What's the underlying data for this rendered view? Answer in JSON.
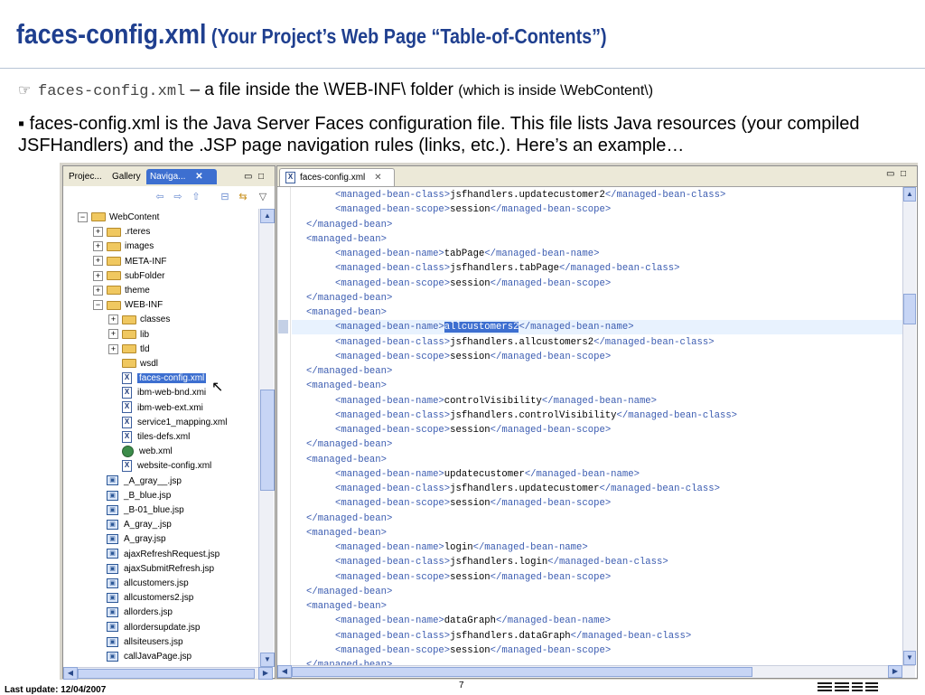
{
  "slide": {
    "title_main": "faces-config.xml",
    "title_sub": " (Your Project’s Web Page “Table-of-Contents”)",
    "bullet1_glyph": "☞",
    "bullet1_mono": "faces-config.xml",
    "bullet1_text": " – a file inside the \\WEB-INF\\ folder ",
    "bullet1_small": "(which is inside \\WebContent\\)",
    "bullet2_glyph": "▪",
    "bullet2_text": " faces-config.xml is the Java Server Faces configuration file. This file lists Java resources (your compiled JSFHandlers) and the .JSP page navigation rules (links, etc.).   Here’s an example…",
    "footer_update": "Last update: 12/04/2007",
    "page_number": "7"
  },
  "navigator": {
    "tabs": [
      "Projec...",
      "Gallery",
      "Naviga..."
    ],
    "close_glyph": "✕",
    "min_glyph": "▭",
    "max_glyph": "□",
    "tool_icons": [
      "⇦",
      "⇨",
      "⇧",
      "⊟",
      "⇆",
      "▽"
    ],
    "tree": [
      {
        "label": "WebContent",
        "icon": "folder",
        "indent": 0,
        "exp": "−"
      },
      {
        "label": ".rteres",
        "icon": "folder",
        "indent": 1,
        "exp": "+"
      },
      {
        "label": "images",
        "icon": "folder",
        "indent": 1,
        "exp": "+"
      },
      {
        "label": "META-INF",
        "icon": "folder",
        "indent": 1,
        "exp": "+"
      },
      {
        "label": "subFolder",
        "icon": "folder",
        "indent": 1,
        "exp": "+"
      },
      {
        "label": "theme",
        "icon": "folder",
        "indent": 1,
        "exp": "+"
      },
      {
        "label": "WEB-INF",
        "icon": "folder",
        "indent": 1,
        "exp": "−"
      },
      {
        "label": "classes",
        "icon": "folder",
        "indent": 2,
        "exp": "+"
      },
      {
        "label": "lib",
        "icon": "folder",
        "indent": 2,
        "exp": "+"
      },
      {
        "label": "tld",
        "icon": "folder",
        "indent": 2,
        "exp": "+"
      },
      {
        "label": "wsdl",
        "icon": "folder",
        "indent": 2,
        "exp": ""
      },
      {
        "label": "faces-config.xml",
        "icon": "xml",
        "indent": 2,
        "exp": "",
        "selected": true
      },
      {
        "label": "ibm-web-bnd.xmi",
        "icon": "xml",
        "indent": 2,
        "exp": ""
      },
      {
        "label": "ibm-web-ext.xmi",
        "icon": "xml",
        "indent": 2,
        "exp": ""
      },
      {
        "label": "service1_mapping.xml",
        "icon": "xml",
        "indent": 2,
        "exp": ""
      },
      {
        "label": "tiles-defs.xml",
        "icon": "xml",
        "indent": 2,
        "exp": ""
      },
      {
        "label": "web.xml",
        "icon": "globe",
        "indent": 2,
        "exp": ""
      },
      {
        "label": "website-config.xml",
        "icon": "xml",
        "indent": 2,
        "exp": ""
      },
      {
        "label": "_A_gray__.jsp",
        "icon": "jsp",
        "indent": 1,
        "exp": ""
      },
      {
        "label": "_B_blue.jsp",
        "icon": "jsp",
        "indent": 1,
        "exp": ""
      },
      {
        "label": "_B-01_blue.jsp",
        "icon": "jsp",
        "indent": 1,
        "exp": ""
      },
      {
        "label": "A_gray_.jsp",
        "icon": "jsp",
        "indent": 1,
        "exp": ""
      },
      {
        "label": "A_gray.jsp",
        "icon": "jsp",
        "indent": 1,
        "exp": ""
      },
      {
        "label": "ajaxRefreshRequest.jsp",
        "icon": "jsp",
        "indent": 1,
        "exp": ""
      },
      {
        "label": "ajaxSubmitRefresh.jsp",
        "icon": "jsp",
        "indent": 1,
        "exp": ""
      },
      {
        "label": "allcustomers.jsp",
        "icon": "jsp",
        "indent": 1,
        "exp": ""
      },
      {
        "label": "allcustomers2.jsp",
        "icon": "jsp",
        "indent": 1,
        "exp": ""
      },
      {
        "label": "allorders.jsp",
        "icon": "jsp",
        "indent": 1,
        "exp": ""
      },
      {
        "label": "allordersupdate.jsp",
        "icon": "jsp",
        "indent": 1,
        "exp": ""
      },
      {
        "label": "allsiteusers.jsp",
        "icon": "jsp",
        "indent": 1,
        "exp": ""
      },
      {
        "label": "callJavaPage.jsp",
        "icon": "jsp",
        "indent": 1,
        "exp": ""
      }
    ]
  },
  "editor": {
    "tab_label": "faces-config.xml",
    "tab_close": "✕",
    "highlight_line": 9,
    "lines": [
      {
        "indent": 2,
        "open": "<managed-bean-class>",
        "value": "jsfhandlers.updatecustomer2",
        "close": "</managed-bean-class>"
      },
      {
        "indent": 2,
        "open": "<managed-bean-scope>",
        "value": "session",
        "close": "</managed-bean-scope>"
      },
      {
        "indent": 1,
        "open": "</managed-bean>",
        "value": "",
        "close": ""
      },
      {
        "indent": 1,
        "open": "<managed-bean>",
        "value": "",
        "close": ""
      },
      {
        "indent": 2,
        "open": "<managed-bean-name>",
        "value": "tabPage",
        "close": "</managed-bean-name>"
      },
      {
        "indent": 2,
        "open": "<managed-bean-class>",
        "value": "jsfhandlers.tabPage",
        "close": "</managed-bean-class>"
      },
      {
        "indent": 2,
        "open": "<managed-bean-scope>",
        "value": "session",
        "close": "</managed-bean-scope>"
      },
      {
        "indent": 1,
        "open": "</managed-bean>",
        "value": "",
        "close": ""
      },
      {
        "indent": 1,
        "open": "<managed-bean>",
        "value": "",
        "close": ""
      },
      {
        "indent": 2,
        "open": "<managed-bean-name>",
        "value": "allcustomers2",
        "close": "</managed-bean-name>",
        "selected": true
      },
      {
        "indent": 2,
        "open": "<managed-bean-class>",
        "value": "jsfhandlers.allcustomers2",
        "close": "</managed-bean-class>"
      },
      {
        "indent": 2,
        "open": "<managed-bean-scope>",
        "value": "session",
        "close": "</managed-bean-scope>"
      },
      {
        "indent": 1,
        "open": "</managed-bean>",
        "value": "",
        "close": ""
      },
      {
        "indent": 1,
        "open": "<managed-bean>",
        "value": "",
        "close": ""
      },
      {
        "indent": 2,
        "open": "<managed-bean-name>",
        "value": "controlVisibility",
        "close": "</managed-bean-name>"
      },
      {
        "indent": 2,
        "open": "<managed-bean-class>",
        "value": "jsfhandlers.controlVisibility",
        "close": "</managed-bean-class>"
      },
      {
        "indent": 2,
        "open": "<managed-bean-scope>",
        "value": "session",
        "close": "</managed-bean-scope>"
      },
      {
        "indent": 1,
        "open": "</managed-bean>",
        "value": "",
        "close": ""
      },
      {
        "indent": 1,
        "open": "<managed-bean>",
        "value": "",
        "close": ""
      },
      {
        "indent": 2,
        "open": "<managed-bean-name>",
        "value": "updatecustomer",
        "close": "</managed-bean-name>"
      },
      {
        "indent": 2,
        "open": "<managed-bean-class>",
        "value": "jsfhandlers.updatecustomer",
        "close": "</managed-bean-class>"
      },
      {
        "indent": 2,
        "open": "<managed-bean-scope>",
        "value": "session",
        "close": "</managed-bean-scope>"
      },
      {
        "indent": 1,
        "open": "</managed-bean>",
        "value": "",
        "close": ""
      },
      {
        "indent": 1,
        "open": "<managed-bean>",
        "value": "",
        "close": ""
      },
      {
        "indent": 2,
        "open": "<managed-bean-name>",
        "value": "login",
        "close": "</managed-bean-name>"
      },
      {
        "indent": 2,
        "open": "<managed-bean-class>",
        "value": "jsfhandlers.login",
        "close": "</managed-bean-class>"
      },
      {
        "indent": 2,
        "open": "<managed-bean-scope>",
        "value": "session",
        "close": "</managed-bean-scope>"
      },
      {
        "indent": 1,
        "open": "</managed-bean>",
        "value": "",
        "close": ""
      },
      {
        "indent": 1,
        "open": "<managed-bean>",
        "value": "",
        "close": ""
      },
      {
        "indent": 2,
        "open": "<managed-bean-name>",
        "value": "dataGraph",
        "close": "</managed-bean-name>"
      },
      {
        "indent": 2,
        "open": "<managed-bean-class>",
        "value": "jsfhandlers.dataGraph",
        "close": "</managed-bean-class>"
      },
      {
        "indent": 2,
        "open": "<managed-bean-scope>",
        "value": "session",
        "close": "</managed-bean-scope>"
      },
      {
        "indent": 1,
        "open": "</managed-bean>",
        "value": "",
        "close": ""
      }
    ]
  },
  "colors": {
    "title": "#1f3f8f",
    "tag": "#3a5bb0",
    "selection": "#3d6fd0",
    "current_line": "#e8f2fe"
  }
}
